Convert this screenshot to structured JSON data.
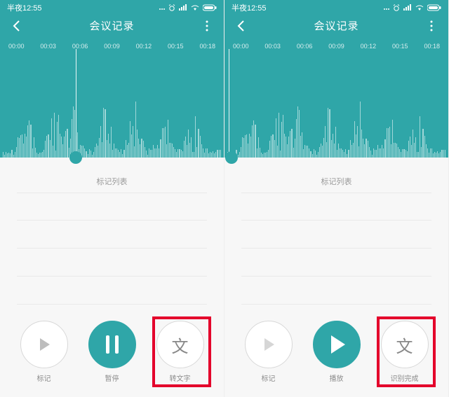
{
  "left": {
    "status_time": "半夜12:55",
    "title": "会议记录",
    "timeline": [
      "00:00",
      "00:03",
      "00:06",
      "00:09",
      "00:12",
      "00:15",
      "00:18"
    ],
    "playhead_percent": 34,
    "marklist_label": "标记列表",
    "controls": {
      "mark": "标记",
      "center": "暂停",
      "text": "转文字",
      "text_glyph": "文",
      "center_mode": "pause"
    }
  },
  "right": {
    "status_time": "半夜12:55",
    "title": "会议记录",
    "timeline": [
      "00:00",
      "00:03",
      "00:06",
      "00:09",
      "00:12",
      "00:15",
      "00:18"
    ],
    "playhead_percent": 2,
    "marklist_label": "标记列表",
    "controls": {
      "mark": "标记",
      "center": "播放",
      "text": "识别完成",
      "text_glyph": "文",
      "center_mode": "play"
    }
  },
  "colors": {
    "accent": "#2fa6a8",
    "highlight": "#e4002b"
  }
}
